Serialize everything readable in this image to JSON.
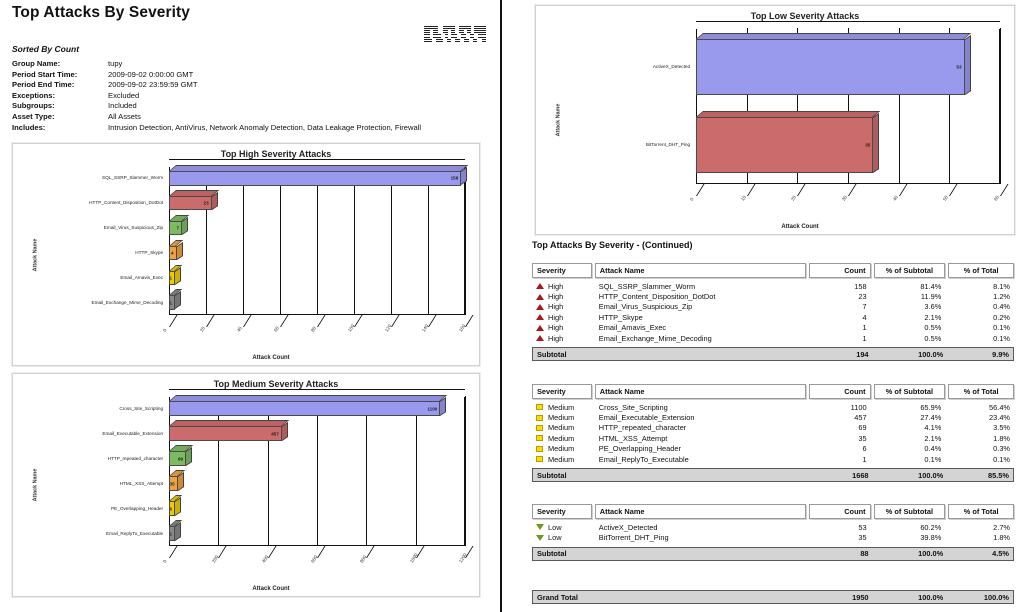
{
  "report": {
    "title": "Top Attacks By Severity",
    "sorted_by": "Sorted By Count",
    "logo": "ibm-logo",
    "meta": [
      {
        "key": "Group Name:",
        "value": "tupy"
      },
      {
        "key": "Period Start Time:",
        "value": "2009-09-02   0:00:00 GMT"
      },
      {
        "key": "Period End Time:",
        "value": "2009-09-02  23:59:59 GMT"
      },
      {
        "key": "Exceptions:",
        "value": "Excluded"
      },
      {
        "key": "Subgroups:",
        "value": "Included"
      },
      {
        "key": "Asset Type:",
        "value": "All Assets"
      },
      {
        "key": "Includes:",
        "value": "Intrusion Detection, AntiVirus, Network Anomaly Detection, Data Leakage Protection, Firewall"
      }
    ],
    "continued_title": "Top Attacks By Severity - (Continued)"
  },
  "chart_data": [
    {
      "id": "high",
      "type": "bar",
      "orientation": "horizontal",
      "title": "Top High Severity Attacks",
      "xlabel": "Attack Count",
      "ylabel": "Attack Name",
      "categories": [
        "SQL_SSRP_Slammer_Worm",
        "HTTP_Content_Disposition_DotDot",
        "Email_Virus_Suspicious_Zip",
        "HTTP_Skype",
        "Email_Amavis_Exec",
        "Email_Exchange_Mime_Decoding"
      ],
      "values": [
        158,
        23,
        7,
        4,
        1,
        1
      ],
      "colors": [
        "#9999ee",
        "#cc6b6b",
        "#7cbb63",
        "#efa040",
        "#eecc00",
        "#888888"
      ],
      "ticks": [
        0,
        20,
        40,
        60,
        80,
        100,
        120,
        140,
        160
      ],
      "xlim": [
        0,
        160
      ],
      "grid": true,
      "legend": "none"
    },
    {
      "id": "medium",
      "type": "bar",
      "orientation": "horizontal",
      "title": "Top Medium Severity Attacks",
      "xlabel": "Attack Count",
      "ylabel": "Attack Name",
      "categories": [
        "Cross_Site_Scripting",
        "Email_Executable_Extension",
        "HTTP_repeated_character",
        "HTML_XSS_Attempt",
        "PE_Overlapping_Header",
        "Email_ReplyTo_Executable"
      ],
      "values": [
        1100,
        457,
        69,
        35,
        6,
        1
      ],
      "colors": [
        "#9999ee",
        "#cc6b6b",
        "#7cbb63",
        "#efa040",
        "#eecc00",
        "#888888"
      ],
      "ticks": [
        0,
        200,
        400,
        600,
        800,
        1000,
        1200
      ],
      "xlim": [
        0,
        1200
      ],
      "grid": true,
      "legend": "none"
    },
    {
      "id": "low",
      "type": "bar",
      "orientation": "horizontal",
      "title": "Top Low Severity Attacks",
      "xlabel": "Attack Count",
      "ylabel": "Attack Name",
      "categories": [
        "ActiveX_Detected",
        "BitTorrent_DHT_Ping"
      ],
      "values": [
        53,
        35
      ],
      "colors": [
        "#9999ee",
        "#cc6b6b"
      ],
      "ticks": [
        0,
        10,
        20,
        30,
        40,
        50,
        60
      ],
      "xlim": [
        0,
        60
      ],
      "grid": true,
      "legend": "none"
    }
  ],
  "table": {
    "columns": [
      "Severity",
      "Attack Name",
      "Count",
      "% of Subtotal",
      "% of Total"
    ],
    "groups": [
      {
        "severity": "High",
        "icon": "triangle-up-red-icon",
        "rows": [
          {
            "severity": "High",
            "name": "SQL_SSRP_Slammer_Worm",
            "count": "158",
            "pct_subtotal": "81.4%",
            "pct_total": "8.1%"
          },
          {
            "severity": "High",
            "name": "HTTP_Content_Disposition_DotDot",
            "count": "23",
            "pct_subtotal": "11.9%",
            "pct_total": "1.2%"
          },
          {
            "severity": "High",
            "name": "Email_Virus_Suspicious_Zip",
            "count": "7",
            "pct_subtotal": "3.6%",
            "pct_total": "0.4%"
          },
          {
            "severity": "High",
            "name": "HTTP_Skype",
            "count": "4",
            "pct_subtotal": "2.1%",
            "pct_total": "0.2%"
          },
          {
            "severity": "High",
            "name": "Email_Amavis_Exec",
            "count": "1",
            "pct_subtotal": "0.5%",
            "pct_total": "0.1%"
          },
          {
            "severity": "High",
            "name": "Email_Exchange_Mime_Decoding",
            "count": "1",
            "pct_subtotal": "0.5%",
            "pct_total": "0.1%"
          }
        ],
        "subtotal": {
          "label": "Subtotal",
          "count": "194",
          "pct_subtotal": "100.0%",
          "pct_total": "9.9%"
        }
      },
      {
        "severity": "Medium",
        "icon": "square-yellow-icon",
        "rows": [
          {
            "severity": "Medium",
            "name": "Cross_Site_Scripting",
            "count": "1100",
            "pct_subtotal": "65.9%",
            "pct_total": "56.4%"
          },
          {
            "severity": "Medium",
            "name": "Email_Executable_Extension",
            "count": "457",
            "pct_subtotal": "27.4%",
            "pct_total": "23.4%"
          },
          {
            "severity": "Medium",
            "name": "HTTP_repeated_character",
            "count": "69",
            "pct_subtotal": "4.1%",
            "pct_total": "3.5%"
          },
          {
            "severity": "Medium",
            "name": "HTML_XSS_Attempt",
            "count": "35",
            "pct_subtotal": "2.1%",
            "pct_total": "1.8%"
          },
          {
            "severity": "Medium",
            "name": "PE_Overlapping_Header",
            "count": "6",
            "pct_subtotal": "0.4%",
            "pct_total": "0.3%"
          },
          {
            "severity": "Medium",
            "name": "Email_ReplyTo_Executable",
            "count": "1",
            "pct_subtotal": "0.1%",
            "pct_total": "0.1%"
          }
        ],
        "subtotal": {
          "label": "Subtotal",
          "count": "1668",
          "pct_subtotal": "100.0%",
          "pct_total": "85.5%"
        }
      },
      {
        "severity": "Low",
        "icon": "triangle-down-green-icon",
        "rows": [
          {
            "severity": "Low",
            "name": "ActiveX_Detected",
            "count": "53",
            "pct_subtotal": "60.2%",
            "pct_total": "2.7%"
          },
          {
            "severity": "Low",
            "name": "BitTorrent_DHT_Ping",
            "count": "35",
            "pct_subtotal": "39.8%",
            "pct_total": "1.8%"
          }
        ],
        "subtotal": {
          "label": "Subtotal",
          "count": "88",
          "pct_subtotal": "100.0%",
          "pct_total": "4.5%"
        }
      }
    ],
    "grand_total": {
      "label": "Grand Total",
      "count": "1950",
      "pct_subtotal": "100.0%",
      "pct_total": "100.0%"
    }
  }
}
